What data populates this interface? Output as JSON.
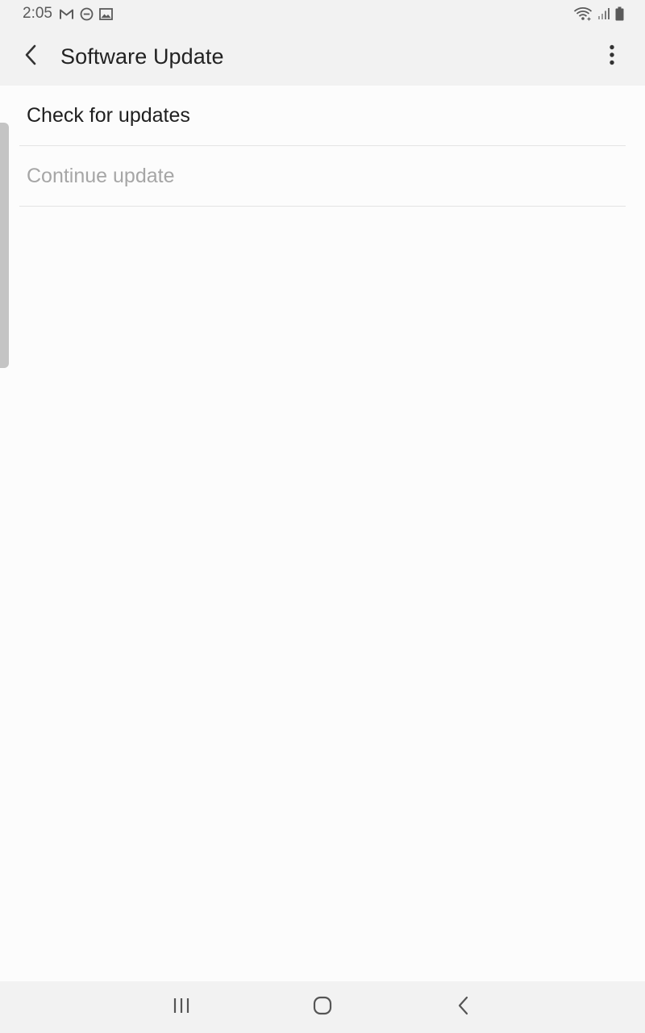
{
  "status_bar": {
    "time": "2:05",
    "left_icons": [
      "gmail-icon",
      "do-not-disturb-icon",
      "gallery-icon"
    ],
    "right_icons": [
      "wifi-icon",
      "cellular-signal-icon",
      "battery-icon"
    ]
  },
  "app_bar": {
    "back_icon": "chevron-left-icon",
    "title": "Software Update",
    "more_icon": "more-vertical-icon"
  },
  "list": {
    "items": [
      {
        "label": "Check for updates",
        "enabled": true
      },
      {
        "label": "Continue update",
        "enabled": false
      }
    ]
  },
  "nav_bar": {
    "recents_icon": "recents-icon",
    "home_icon": "home-icon",
    "back_icon": "back-icon"
  },
  "colors": {
    "background": "#fcfcfc",
    "bars": "#f2f2f2",
    "text_primary": "#1f1f1f",
    "text_disabled": "#a6a6a6",
    "divider": "#e4e4e4"
  }
}
